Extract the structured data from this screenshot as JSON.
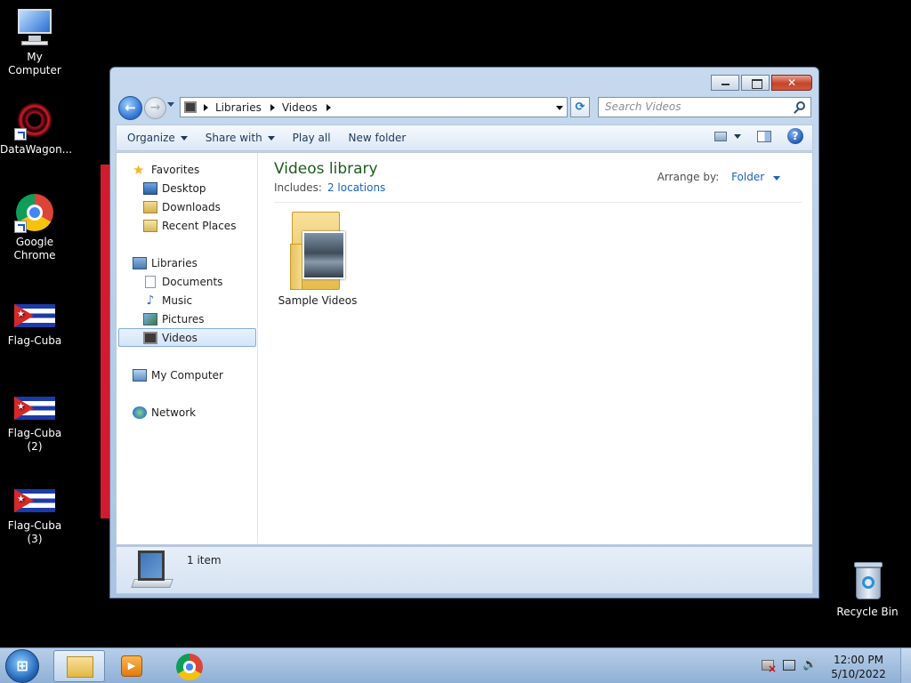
{
  "desktop": {
    "icons": [
      {
        "label": "My Computer",
        "icon": "computer-icon"
      },
      {
        "label": "DataWagon...",
        "icon": "datawagon-icon"
      },
      {
        "label": "Google Chrome",
        "icon": "chrome-icon"
      },
      {
        "label": "Flag-Cuba",
        "icon": "flag-cuba-icon"
      },
      {
        "label": "Flag-Cuba (2)",
        "icon": "flag-cuba-icon"
      },
      {
        "label": "Flag-Cuba (3)",
        "icon": "flag-cuba-icon"
      },
      {
        "label": "Recycle Bin",
        "icon": "recycle-bin-icon"
      }
    ]
  },
  "window": {
    "close_glyph": "✕",
    "address": {
      "crumbs": [
        "Libraries",
        "Videos"
      ]
    },
    "search": {
      "placeholder": "Search Videos"
    },
    "toolbar": {
      "organize": "Organize",
      "share_with": "Share with",
      "play_all": "Play all",
      "new_folder": "New folder",
      "help": "?"
    },
    "nav": {
      "favorites": "Favorites",
      "desktop": "Desktop",
      "downloads": "Downloads",
      "recent_places": "Recent Places",
      "libraries": "Libraries",
      "documents": "Documents",
      "music": "Music",
      "pictures": "Pictures",
      "videos": "Videos",
      "my_computer": "My Computer",
      "network": "Network"
    },
    "library": {
      "title": "Videos library",
      "includes_label": "Includes:",
      "includes_link": "2 locations",
      "arrange_label": "Arrange by:",
      "arrange_value": "Folder"
    },
    "items": [
      {
        "name": "Sample Videos",
        "icon": "folder-icon"
      }
    ],
    "status": {
      "count": "1 item"
    }
  },
  "taskbar": {
    "start_glyph": "⊞",
    "media_glyph": "▶",
    "time": "12:00 PM",
    "date": "5/10/2022"
  },
  "colors": {
    "library_title": "#1e5c1e",
    "link": "#1a63c1",
    "close_button": "#c5432b",
    "selection": "#d1e5fb"
  }
}
